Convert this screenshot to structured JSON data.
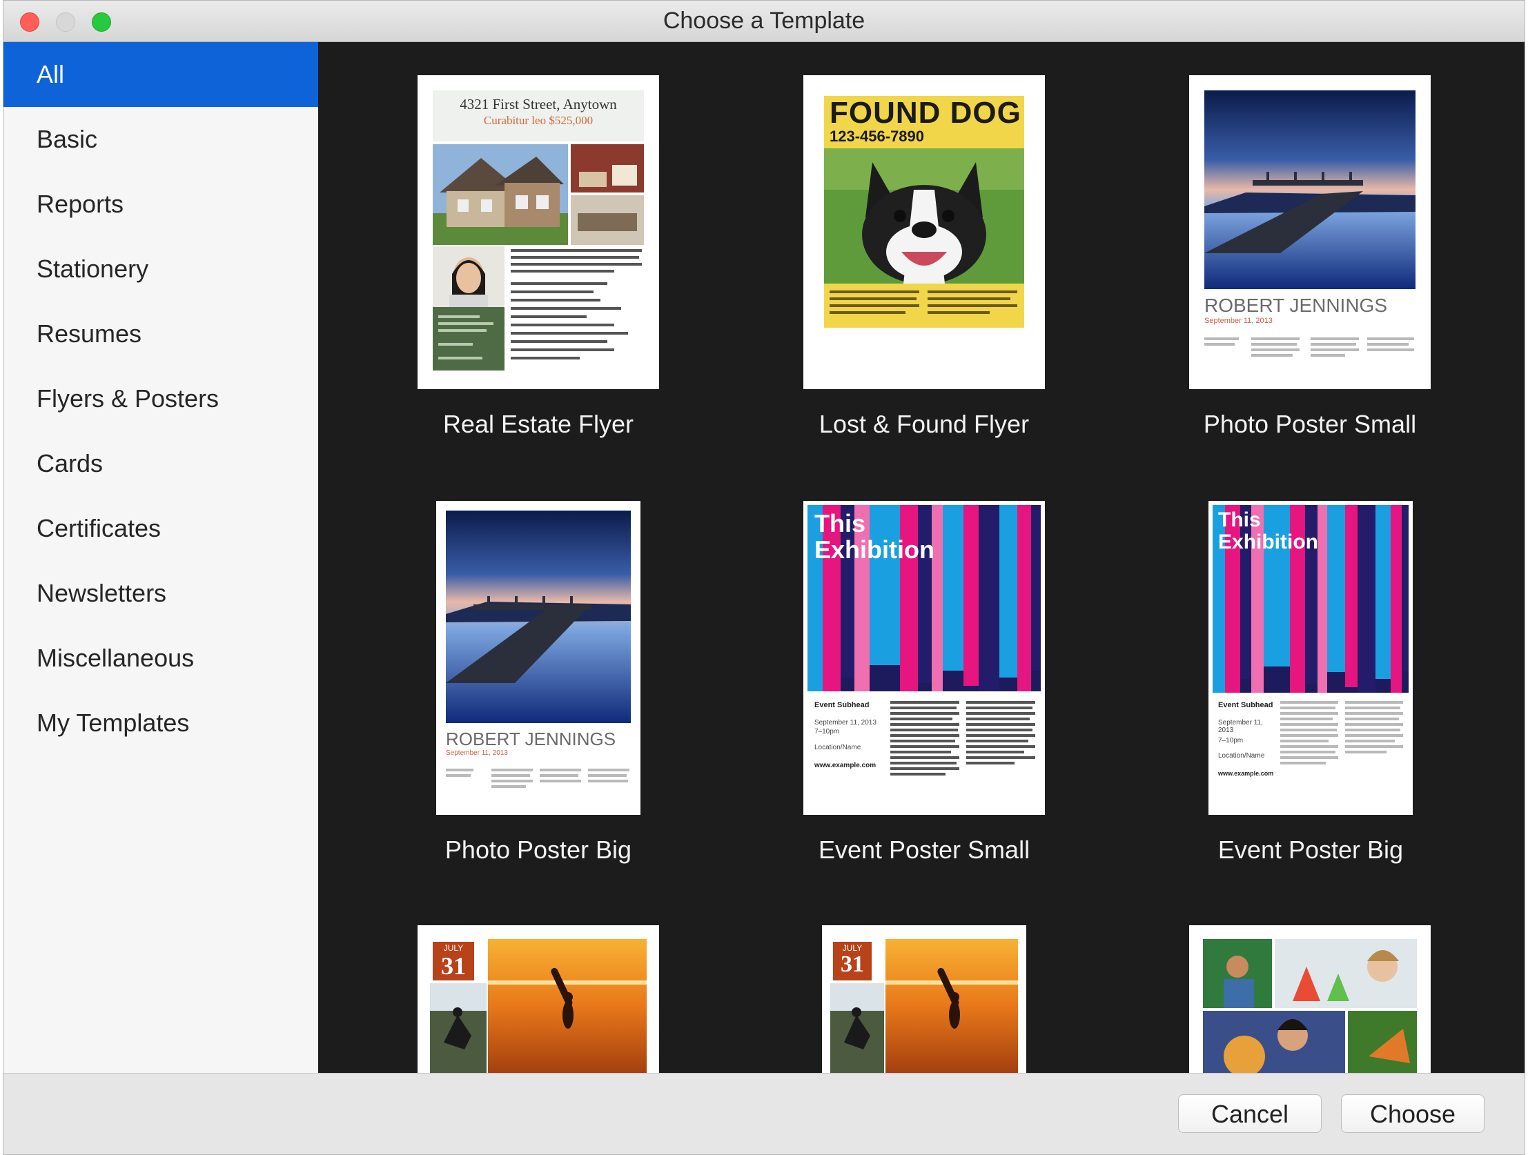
{
  "window": {
    "title": "Choose a Template"
  },
  "sidebar": {
    "items": [
      {
        "label": "All"
      },
      {
        "label": "Basic"
      },
      {
        "label": "Reports"
      },
      {
        "label": "Stationery"
      },
      {
        "label": "Resumes"
      },
      {
        "label": "Flyers & Posters"
      },
      {
        "label": "Cards"
      },
      {
        "label": "Certificates"
      },
      {
        "label": "Newsletters"
      },
      {
        "label": "Miscellaneous"
      },
      {
        "label": "My Templates"
      }
    ],
    "selected": "All"
  },
  "templates": [
    {
      "name": "Real Estate Flyer"
    },
    {
      "name": "Lost & Found Flyer"
    },
    {
      "name": "Photo Poster Small"
    },
    {
      "name": "Photo Poster Big"
    },
    {
      "name": "Event Poster Small"
    },
    {
      "name": "Event Poster Big"
    },
    {
      "name": ""
    },
    {
      "name": ""
    },
    {
      "name": ""
    }
  ],
  "thumbs": {
    "real_estate": {
      "address": "4321 First Street, Anytown",
      "price": "Curabitur leo $525,000"
    },
    "found_dog": {
      "heading": "FOUND DOG",
      "phone": "123-456-7890"
    },
    "photo_poster": {
      "name": "ROBERT JENNINGS",
      "date": "September 11, 2013"
    },
    "event_poster": {
      "heading_1": "This",
      "heading_2": "Exhibition",
      "subhead": "Event Subhead",
      "date": "September 11, 2013",
      "time": "7–10pm",
      "location": "Location/Name",
      "url": "www.example.com"
    },
    "calendar": {
      "month": "JULY",
      "day": "31"
    }
  },
  "footer": {
    "cancel_label": "Cancel",
    "choose_label": "Choose"
  }
}
